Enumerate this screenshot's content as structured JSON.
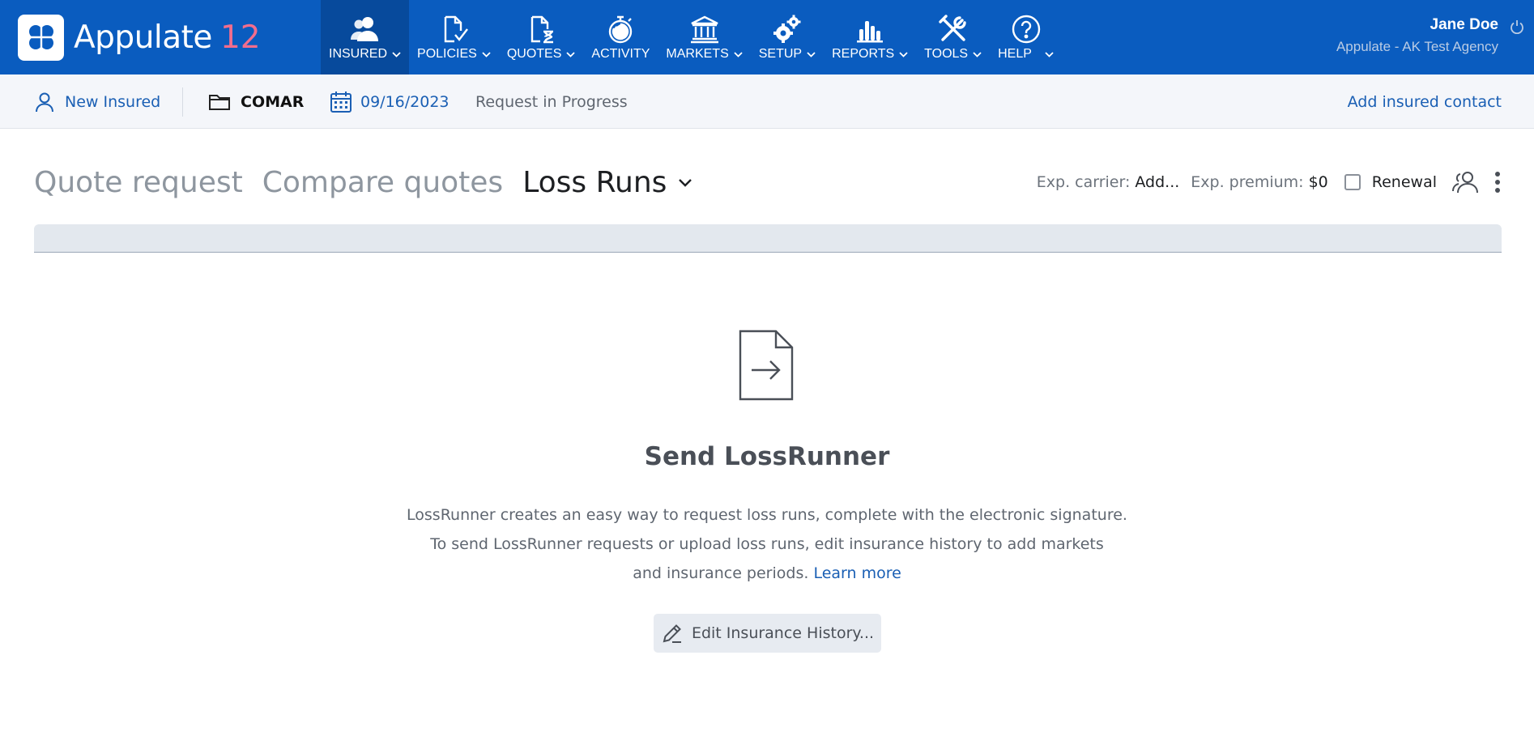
{
  "app": {
    "name": "Appulate",
    "version": "12",
    "logo_icon": "clover-icon",
    "colors": {
      "topbar": "#0a5cbf",
      "active_nav": "#074a9c",
      "version": "#f26d8d",
      "link": "#1a5fb4"
    }
  },
  "nav": [
    {
      "label": "INSURED",
      "icon": "insured-icon",
      "dropdown": true,
      "active": true
    },
    {
      "label": "POLICIES",
      "icon": "policies-icon",
      "dropdown": true
    },
    {
      "label": "QUOTES",
      "icon": "quotes-icon",
      "dropdown": true
    },
    {
      "label": "ACTIVITY",
      "icon": "activity-icon",
      "dropdown": false
    },
    {
      "label": "MARKETS",
      "icon": "markets-icon",
      "dropdown": true
    },
    {
      "label": "SETUP",
      "icon": "setup-icon",
      "dropdown": true
    },
    {
      "label": "REPORTS",
      "icon": "reports-icon",
      "dropdown": true
    },
    {
      "label": "TOOLS",
      "icon": "tools-icon",
      "dropdown": true
    },
    {
      "label": "HELP",
      "icon": "help-icon",
      "dropdown": true
    }
  ],
  "user": {
    "name": "Jane Doe",
    "agency": "Appulate - AK Test Agency"
  },
  "subbar": {
    "insured": "New Insured",
    "folder": "COMAR",
    "date": "09/16/2023",
    "status": "Request in Progress",
    "add_contact": "Add insured contact"
  },
  "tabs": {
    "quote_request": "Quote request",
    "compare_quotes": "Compare quotes",
    "loss_runs": "Loss Runs"
  },
  "info": {
    "exp_carrier_label": "Exp. carrier:",
    "exp_carrier_value": "Add...",
    "exp_premium_label": "Exp. premium:",
    "exp_premium_value": "$0",
    "renewal_label": "Renewal",
    "renewal_checked": false
  },
  "empty_state": {
    "title": "Send LossRunner",
    "line1": "LossRunner creates an easy way to request loss runs, complete with the electronic signature.",
    "line2": "To send LossRunner requests or upload loss runs, edit insurance history to add markets",
    "line3": "and insurance periods.",
    "learn_more": "Learn more",
    "button": "Edit Insurance History..."
  }
}
